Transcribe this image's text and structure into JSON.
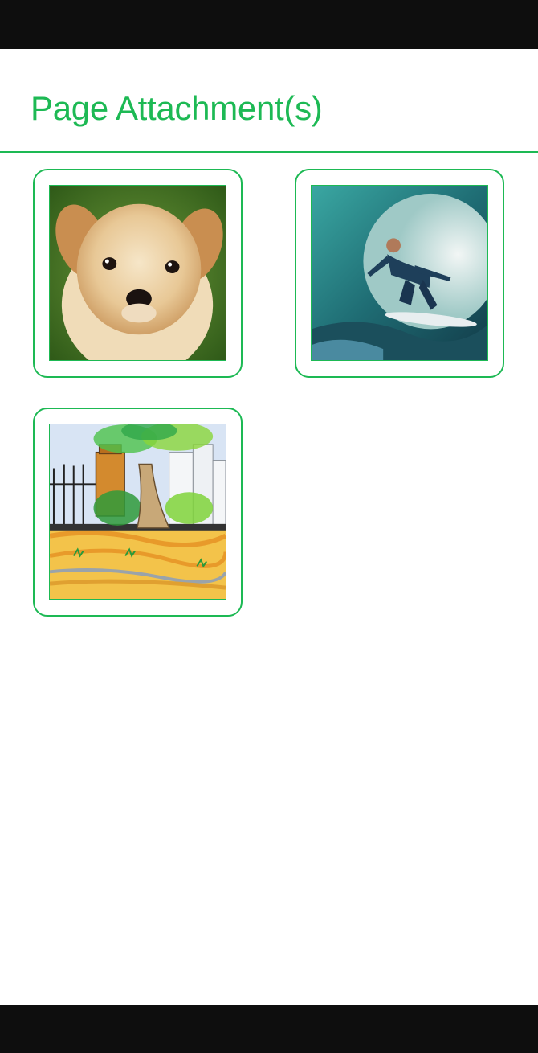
{
  "header": {
    "title": "Page Attachment(s)"
  },
  "attachments": [
    {
      "icon": "puppy-photo"
    },
    {
      "icon": "surfer-photo"
    },
    {
      "icon": "tree-sketch"
    }
  ],
  "colors": {
    "accent": "#1db954",
    "system_bar": "#0e0e0e"
  }
}
